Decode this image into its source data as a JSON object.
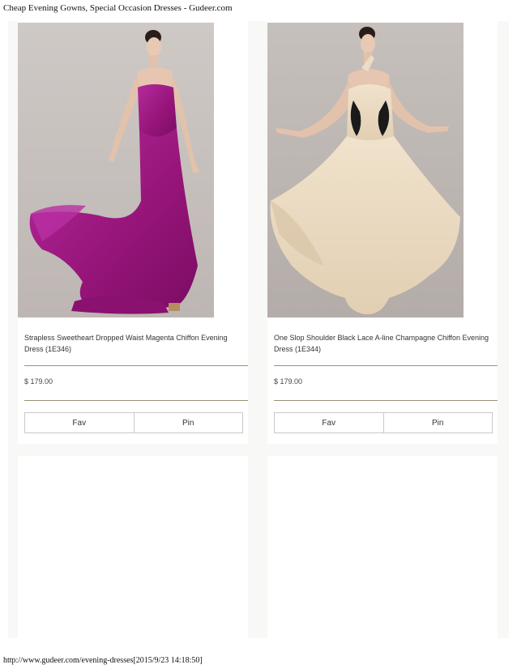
{
  "header": {
    "title": "Cheap Evening Gowns, Special Occasion Dresses - Gudeer.com"
  },
  "footer": {
    "url": "http://www.gudeer.com/evening-dresses[2015/9/23 14:18:50]"
  },
  "products": [
    {
      "title": "Strapless Sweetheart Dropped Waist Magenta Chiffon Evening Dress (1E346)",
      "price": "$ 179.00",
      "fav_label": "Fav",
      "pin_label": "Pin",
      "dress_color": "#a3198b"
    },
    {
      "title": "One Slop Shoulder Black Lace A-line Champagne Chiffon Evening Dress (1E344)",
      "price": "$ 179.00",
      "fav_label": "Fav",
      "pin_label": "Pin",
      "dress_color": "#ecdcc4"
    }
  ],
  "colors": {
    "page_bg": "#f8f8f6",
    "card_bg": "#ffffff",
    "rule": "#9a9275",
    "photo_bg": "#c9c3c0"
  }
}
